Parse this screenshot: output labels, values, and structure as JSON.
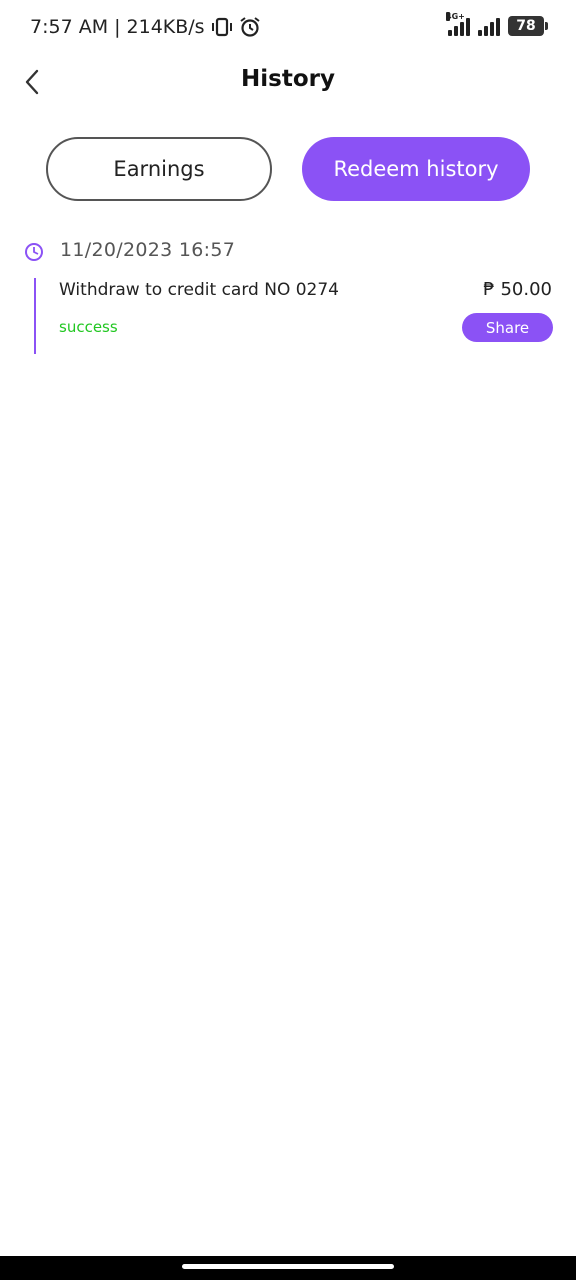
{
  "status_bar": {
    "time": "7:57 AM",
    "separator": "|",
    "speed": "214KB/s",
    "network": "4G+",
    "battery": "78"
  },
  "header": {
    "title": "History",
    "back_icon": "chevron-left-icon"
  },
  "tabs": [
    {
      "label": "Earnings",
      "active": false
    },
    {
      "label": "Redeem history",
      "active": true
    }
  ],
  "records": [
    {
      "date": "11/20/2023 16:57",
      "description": "Withdraw to credit card NO 0274",
      "amount": "₱ 50.00",
      "status": "success",
      "share_label": "Share"
    }
  ],
  "colors": {
    "accent": "#8b52f5",
    "success": "#22c722"
  }
}
